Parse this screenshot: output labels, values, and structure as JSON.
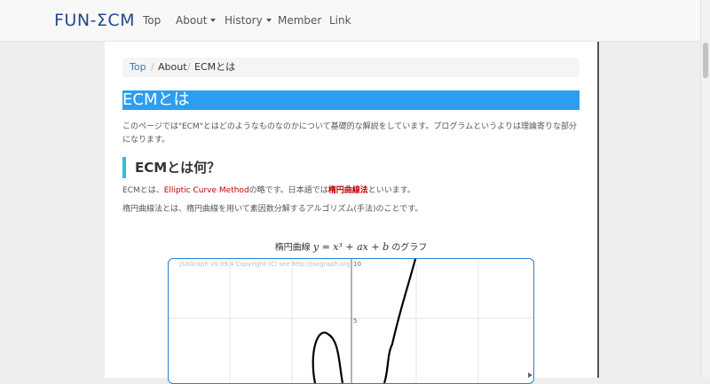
{
  "nav": {
    "brand": "FUN-ΣCM",
    "items": [
      "Top",
      "About",
      "History",
      "Member",
      "Link"
    ]
  },
  "breadcrumb": [
    "Top",
    "About",
    "ECMとは"
  ],
  "h1": "ECMとは",
  "intro": "このページでは\"ECM\"とはどのようなものなのかについて基礎的な解説をしています。プログラムというよりは理論寄りな部分になります。",
  "section": {
    "heading": "ECMとは何？",
    "p1_prefix": "ECMとは、",
    "p1_em": "Elliptic Curve Method",
    "p1_mid": "の略です。日本語では",
    "p1_bold": "楕円曲線法",
    "p1_suffix": "といいます。",
    "p2": "楕円曲線法とは、楕円曲線を用いて素因数分解するアルゴリズム(手法)のことです。"
  },
  "graph": {
    "title_prefix": "楕円曲線",
    "title_math": "y = x³ + ax + b",
    "title_suffix": "のグラフ",
    "copyright": "JSXGraph v0.99.4 Copyright (C) see http://jsxgraph.org",
    "y_tick_labels": [
      "10",
      "5"
    ]
  },
  "colors": {
    "accent": "#2b9ef0",
    "link": "#337ab7",
    "emphasis": "#c00000"
  }
}
